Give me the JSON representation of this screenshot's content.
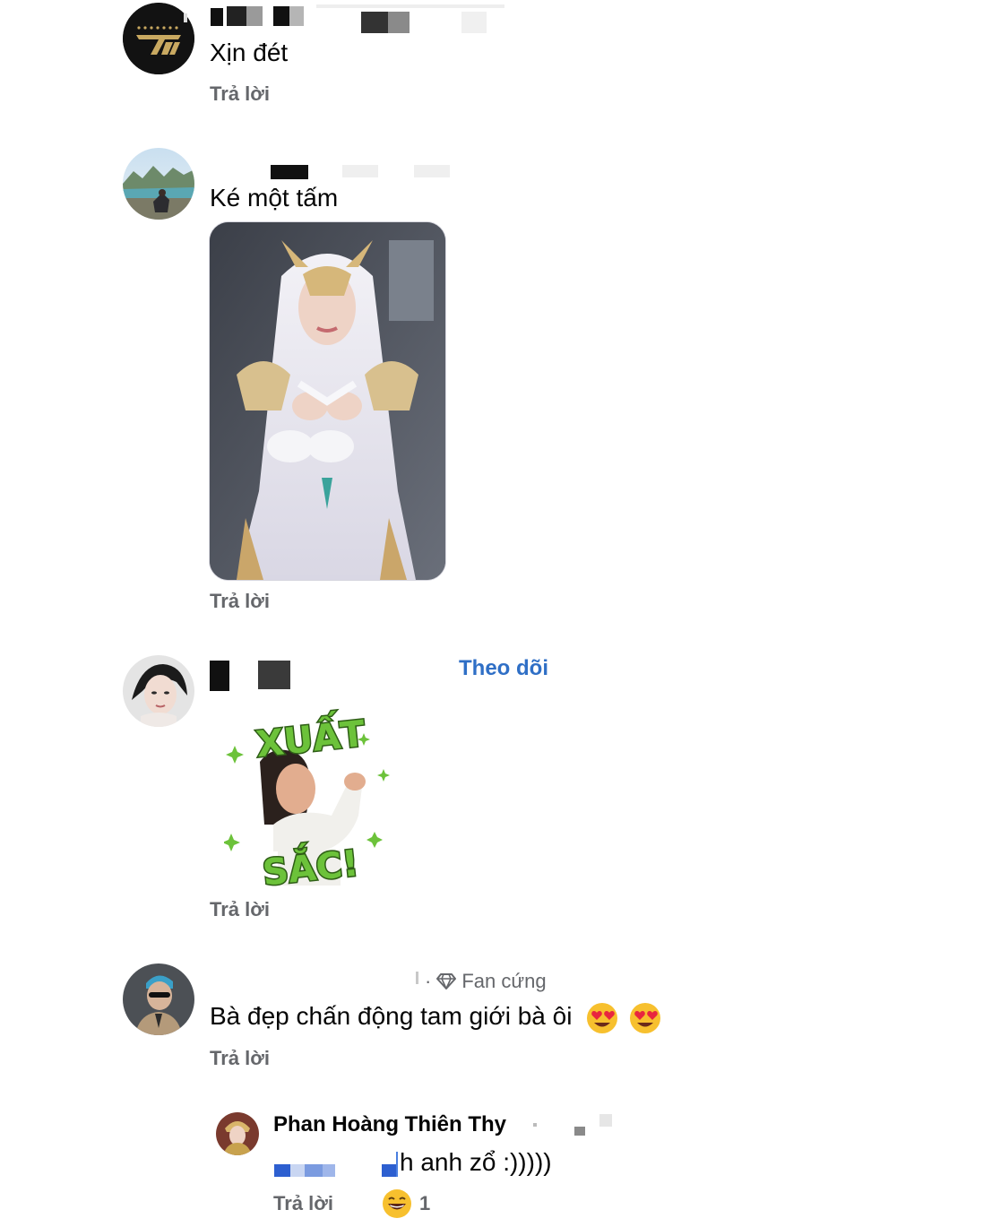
{
  "comments": [
    {
      "text": "Xịn đét",
      "reply_label": "Trả lời"
    },
    {
      "text": "Ké một tấm",
      "reply_label": "Trả lời"
    },
    {
      "follow_label": "Theo dõi",
      "sticker_text_top": "XUẤT",
      "sticker_text_bottom": "SẮC!",
      "reply_label": "Trả lời"
    },
    {
      "badge_label": "Fan cứng",
      "text": "Bà đẹp chấn động tam giới bà ôi",
      "reply_label": "Trả lời"
    }
  ],
  "reply": {
    "author": "Phan Hoàng Thiên Thy",
    "text": "h anh zổ :)))))",
    "reply_label": "Trả lời",
    "reaction_count": "1"
  },
  "icons": {
    "badge": "diamond-icon",
    "reaction": "laughing-emoji-icon",
    "comment_emoji": "heart-eyes-emoji-icon"
  },
  "colors": {
    "follow": "#2f6fc6",
    "meta_text": "#65676b",
    "body_text": "#050505",
    "sticker_green": "#6cc23a"
  }
}
